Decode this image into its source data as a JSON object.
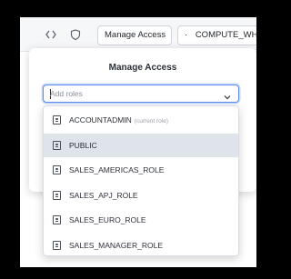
{
  "toolbar": {
    "icons": [
      "code-brackets-icon",
      "shield-icon"
    ],
    "manage_access_label": "Manage Access",
    "warehouse_label": "COMPUTE_WH",
    "warehouse_prefix": "·"
  },
  "modal": {
    "title": "Manage Access",
    "roles_placeholder": "Add roles"
  },
  "dropdown": {
    "items": [
      {
        "label": "ACCOUNTADMIN",
        "note": "(current role)"
      },
      {
        "label": "PUBLIC",
        "note": ""
      },
      {
        "label": "SALES_AMERICAS_ROLE",
        "note": ""
      },
      {
        "label": "SALES_APJ_ROLE",
        "note": ""
      },
      {
        "label": "SALES_EURO_ROLE",
        "note": ""
      },
      {
        "label": "SALES_MANAGER_ROLE",
        "note": ""
      }
    ],
    "highlighted_item": "PUBLIC"
  },
  "colors": {
    "focus_border": "#5b8ef0",
    "highlight_row": "#dfe3ea",
    "background": "#000000"
  }
}
